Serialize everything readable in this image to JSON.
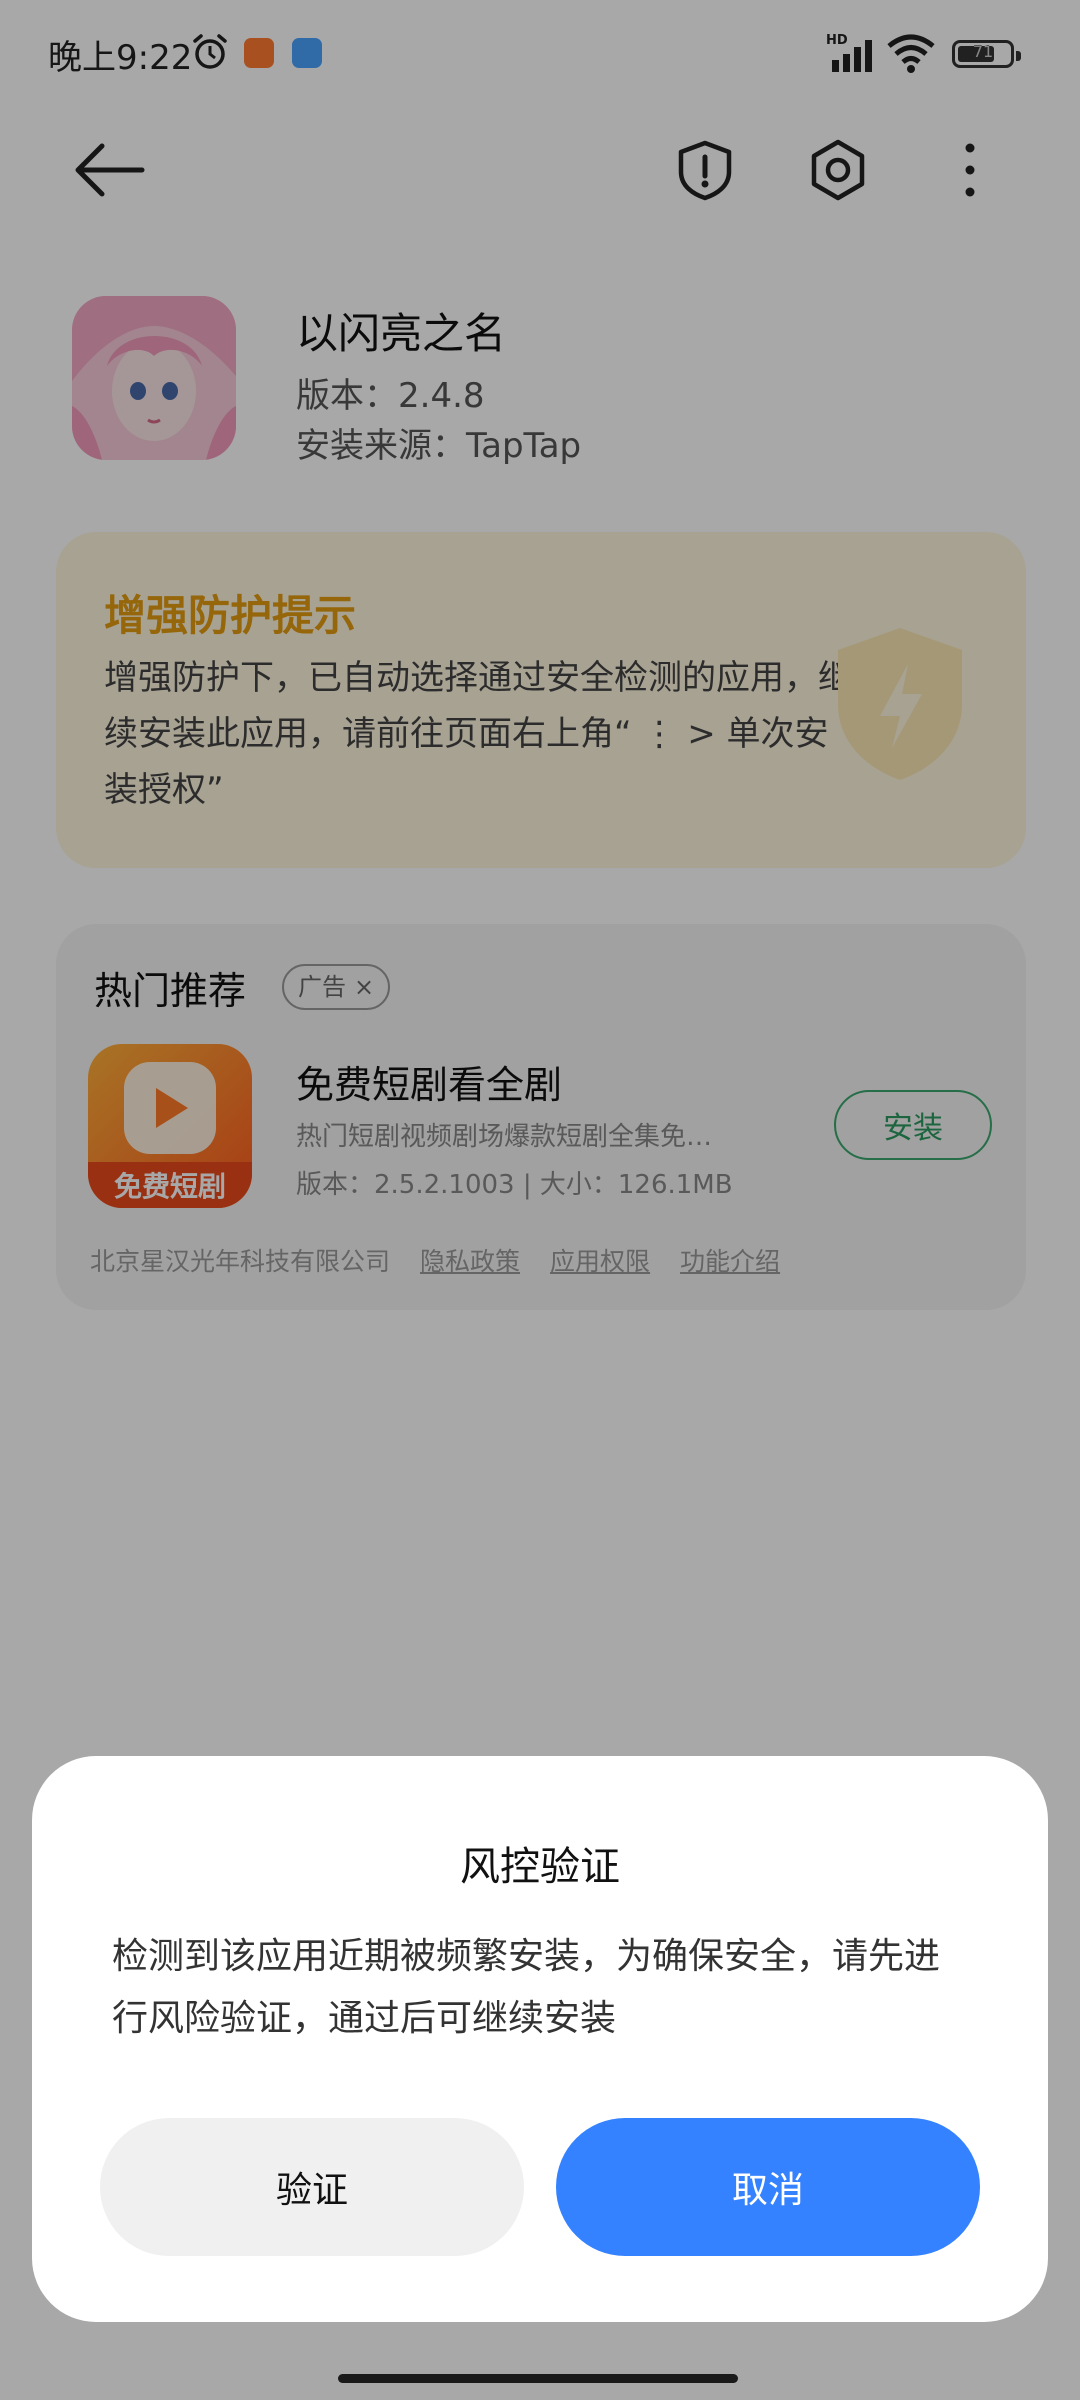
{
  "status_bar": {
    "time": "晚上9:22",
    "battery": "71",
    "battery_level": 0.71,
    "network_label": "HD"
  },
  "app": {
    "title": "以闪亮之名",
    "version": "版本：2.4.8",
    "source": "安装来源：TapTap",
    "icon": "app-icon-anime-girl"
  },
  "protect_card": {
    "title": "增强防护提示",
    "text": "增强防护下，已自动选择通过安全检测的应用，继续安装此应用，请前往页面右上角“ ⋮ > 单次安装授权”",
    "icon": "shield-lightning-icon"
  },
  "recommend": {
    "title": "热门推荐",
    "ad_label": "广告",
    "ad_close": "×",
    "app_name": "免费短剧看全剧",
    "app_desc": "热门短剧视频剧场爆款短剧全集免…",
    "app_meta": "版本：2.5.2.1003 | 大小：126.1MB",
    "app_icon_text": "免费短剧",
    "install_label": "安装",
    "developer": "北京星汉光年科技有限公司",
    "privacy": "隐私政策",
    "permissions": "应用权限",
    "features": "功能介绍"
  },
  "dialog": {
    "title": "风控验证",
    "message": "检测到该应用近期被频繁安装，为确保安全，请先进行风险验证，通过后可继续安装",
    "verify_label": "验证",
    "cancel_label": "取消"
  },
  "colors": {
    "accent_blue": "#3482ff",
    "warning_orange": "#e39b10",
    "install_green": "#2b9a5f"
  }
}
